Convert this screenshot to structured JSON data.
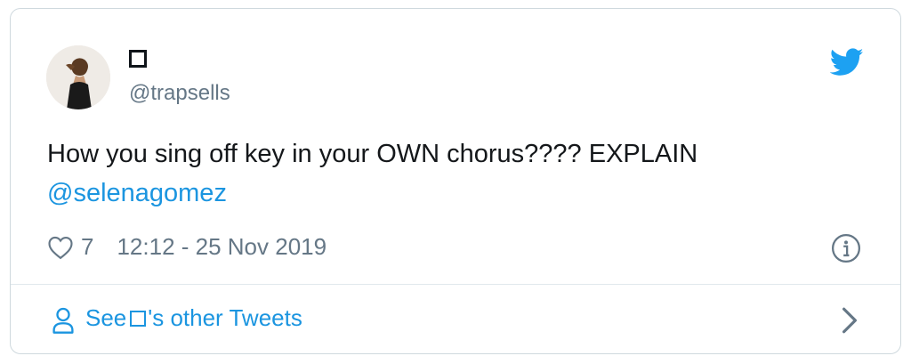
{
  "user": {
    "handle": "@trapsells"
  },
  "tweet": {
    "text_line1": "How you sing off key in your OWN chorus???? EXPLAIN",
    "mention": "@selenagomez",
    "likes": "7",
    "timestamp": "12:12 - 25 Nov 2019"
  },
  "footer": {
    "prefix": "See",
    "suffix": "'s other Tweets"
  },
  "icons": {
    "brand": "twitter-bird-icon",
    "like": "heart-icon",
    "info": "info-icon",
    "profile": "person-icon",
    "chevron": "chevron-right-icon"
  },
  "colors": {
    "accent": "#1b95e0",
    "text": "#14171a",
    "muted": "#657786",
    "border": "#cfd9de"
  }
}
